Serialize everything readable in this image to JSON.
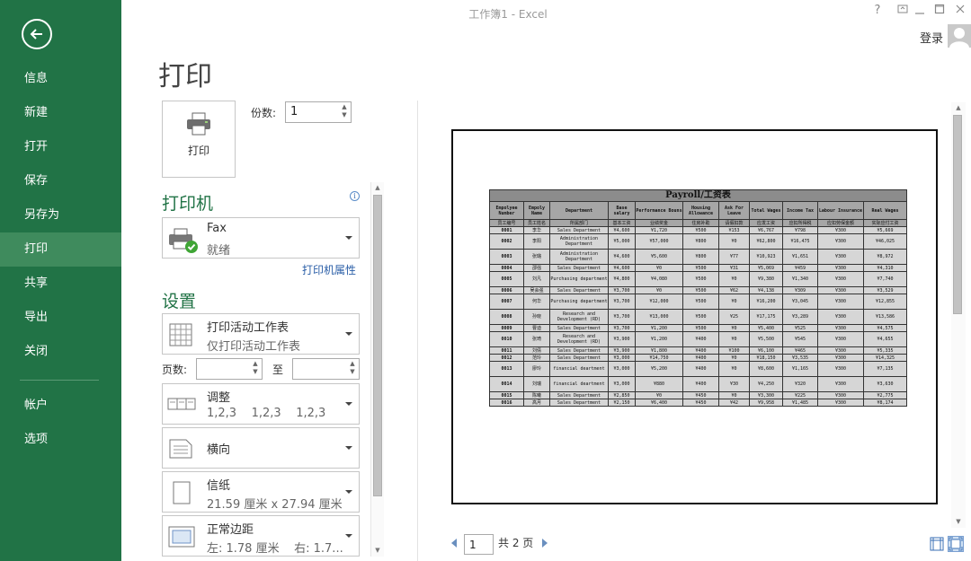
{
  "app": {
    "window_title": "工作簿1 - Excel",
    "help": "?",
    "login": "登录"
  },
  "sidebar": {
    "items": [
      {
        "label": "信息"
      },
      {
        "label": "新建"
      },
      {
        "label": "打开"
      },
      {
        "label": "保存"
      },
      {
        "label": "另存为"
      },
      {
        "label": "打印",
        "active": true
      },
      {
        "label": "共享"
      },
      {
        "label": "导出"
      },
      {
        "label": "关闭"
      },
      {
        "label": "帐户"
      },
      {
        "label": "选项"
      }
    ]
  },
  "print": {
    "page_title": "打印",
    "button_label": "打印",
    "copies_label": "份数:",
    "copies_value": "1"
  },
  "printer": {
    "heading": "打印机",
    "name": "Fax",
    "status": "就绪",
    "properties_link": "打印机属性"
  },
  "settings": {
    "heading": "设置",
    "what": {
      "title": "打印活动工作表",
      "sub": "仅打印活动工作表"
    },
    "pages_label": "页数:",
    "pages_from": "",
    "to_label": "至",
    "pages_to": "",
    "collate": {
      "title": "调整",
      "sub": "1,2,3    1,2,3    1,2,3"
    },
    "orientation": {
      "title": "横向"
    },
    "paper": {
      "title": "信纸",
      "sub": "21.59 厘米 x 27.94 厘米"
    },
    "margins": {
      "title": "正常边距",
      "sub": "左: 1.78 厘米    右: 1.7..."
    }
  },
  "preview": {
    "current_page": "1",
    "total_pages": "共 2 页",
    "table": {
      "title": "Payroll/工资表",
      "headers_en": [
        "Empolyee Number",
        "Empoly Name",
        "Department",
        "Base salary",
        "Performance Bouns",
        "Housing Allowance",
        "Ask For Leave",
        "Total Wages",
        "Income Tax",
        "Labour Insurance",
        "Real Wages"
      ],
      "headers_cn": [
        "员工编号",
        "员工姓名",
        "所属部门",
        "基本工资",
        "业绩奖金",
        "住房补助",
        "请假扣款",
        "应发工资",
        "应扣所得税",
        "应扣劳保金额",
        "实际应付工资"
      ],
      "rows": [
        [
          "0001",
          "李华",
          "Sales Department",
          "¥4,600",
          "¥1,720",
          "¥500",
          "¥153",
          "¥6,767",
          "¥798",
          "¥300",
          "¥5,669"
        ],
        [
          "0002",
          "李阳",
          "Administration Department",
          "¥5,000",
          "¥57,000",
          "¥800",
          "¥0",
          "¥62,800",
          "¥16,475",
          "¥300",
          "¥46,025"
        ],
        [
          "0003",
          "张璐",
          "Administration Department",
          "¥4,600",
          "¥5,600",
          "¥800",
          "¥77",
          "¥10,923",
          "¥1,651",
          "¥300",
          "¥8,972"
        ],
        [
          "0004",
          "邵强",
          "Sales Department",
          "¥4,600",
          "¥0",
          "¥500",
          "¥31",
          "¥5,069",
          "¥459",
          "¥300",
          "¥4,310"
        ],
        [
          "0005",
          "刘凡",
          "Purchasing department",
          "¥4,800",
          "¥4,080",
          "¥500",
          "¥0",
          "¥9,380",
          "¥1,340",
          "¥300",
          "¥7,740"
        ],
        [
          "0006",
          "吴会强",
          "Sales Department",
          "¥3,700",
          "¥0",
          "¥500",
          "¥62",
          "¥4,138",
          "¥309",
          "¥300",
          "¥3,529"
        ],
        [
          "0007",
          "何华",
          "Purchasing department",
          "¥3,700",
          "¥12,000",
          "¥500",
          "¥0",
          "¥16,200",
          "¥3,045",
          "¥300",
          "¥12,855"
        ],
        [
          "0008",
          "孙晓",
          "Research and Development (RD)",
          "¥3,700",
          "¥13,000",
          "¥500",
          "¥25",
          "¥17,175",
          "¥3,289",
          "¥300",
          "¥13,586"
        ],
        [
          "0009",
          "曹迪",
          "Sales Department",
          "¥3,700",
          "¥1,200",
          "¥500",
          "¥0",
          "¥5,400",
          "¥525",
          "¥300",
          "¥4,575"
        ],
        [
          "0010",
          "张琦",
          "Research and Development (RD)",
          "¥3,900",
          "¥1,200",
          "¥400",
          "¥0",
          "¥5,500",
          "¥545",
          "¥300",
          "¥4,655"
        ],
        [
          "0011",
          "刘倩",
          "Sales Department",
          "¥3,900",
          "¥1,800",
          "¥400",
          "¥100",
          "¥6,100",
          "¥465",
          "¥300",
          "¥5,335"
        ],
        [
          "0012",
          "范玲",
          "Sales Department",
          "¥3,000",
          "¥14,750",
          "¥400",
          "¥0",
          "¥18,150",
          "¥3,535",
          "¥300",
          "¥14,325"
        ],
        [
          "0013",
          "廖玲",
          "financial deartment",
          "¥3,000",
          "¥5,200",
          "¥400",
          "¥0",
          "¥8,600",
          "¥1,165",
          "¥300",
          "¥7,135"
        ],
        [
          "0014",
          "刘瑞",
          "financial deartment",
          "¥3,000",
          "¥880",
          "¥400",
          "¥30",
          "¥4,250",
          "¥320",
          "¥300",
          "¥3,630"
        ],
        [
          "0015",
          "陈曦",
          "Sales Department",
          "¥2,850",
          "¥0",
          "¥450",
          "¥0",
          "¥3,300",
          "¥225",
          "¥300",
          "¥2,775"
        ],
        [
          "0016",
          "高月",
          "Sales Department",
          "¥2,150",
          "¥6,400",
          "¥450",
          "¥42",
          "¥9,958",
          "¥1,485",
          "¥300",
          "¥8,174"
        ]
      ]
    }
  }
}
